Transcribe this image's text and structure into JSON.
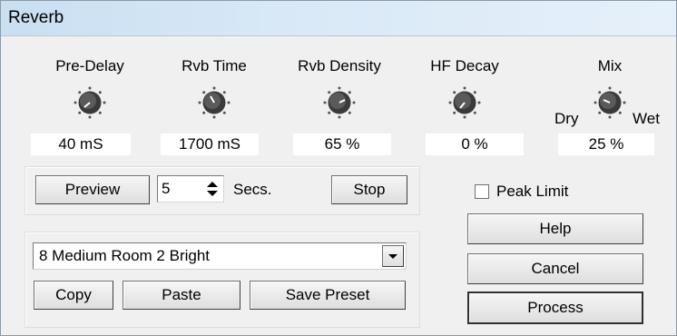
{
  "window": {
    "title": "Reverb"
  },
  "knobs": [
    {
      "label": "Pre-Delay",
      "value": "40 mS"
    },
    {
      "label": "Rvb Time",
      "value": "1700 mS"
    },
    {
      "label": "Rvb Density",
      "value": "65 %"
    },
    {
      "label": "HF Decay",
      "value": "0 %"
    },
    {
      "label": "Mix",
      "value": "25 %",
      "left_label": "Dry",
      "right_label": "Wet"
    }
  ],
  "preview": {
    "preview_label": "Preview",
    "seconds_value": "5",
    "seconds_unit": "Secs.",
    "stop_label": "Stop"
  },
  "peak_limit": {
    "label": "Peak Limit",
    "checked": false
  },
  "preset": {
    "selected": "8 Medium Room 2 Bright",
    "copy_label": "Copy",
    "paste_label": "Paste",
    "save_label": "Save Preset"
  },
  "actions": {
    "help_label": "Help",
    "cancel_label": "Cancel",
    "process_label": "Process"
  },
  "icons": {
    "knob": "rotary-knob-icon",
    "spinner": "up-down-arrows-icon",
    "dropdown": "chevron-down-icon"
  }
}
